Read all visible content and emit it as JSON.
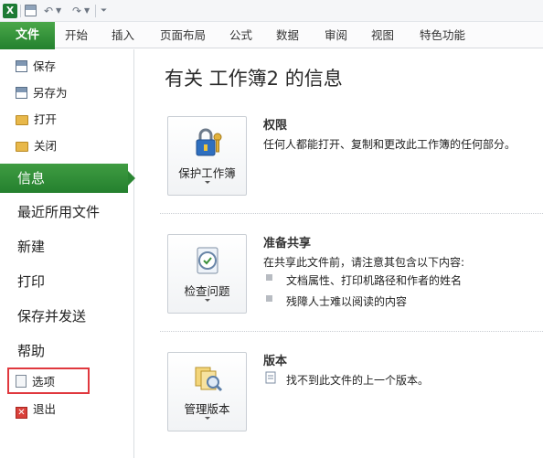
{
  "app_icon_letter": "X",
  "ribbon": {
    "file_tab": "文件",
    "tabs": [
      "开始",
      "插入",
      "页面布局",
      "公式",
      "数据",
      "审阅",
      "视图",
      "特色功能"
    ]
  },
  "nav": {
    "save": "保存",
    "save_as": "另存为",
    "open": "打开",
    "close": "关闭",
    "info": "信息",
    "recent": "最近所用文件",
    "new": "新建",
    "print": "打印",
    "save_send": "保存并发送",
    "help": "帮助",
    "options": "选项",
    "exit": "退出"
  },
  "main": {
    "title": "有关 工作簿2 的信息",
    "permissions": {
      "button": "保护工作簿",
      "heading": "权限",
      "text": "任何人都能打开、复制和更改此工作簿的任何部分。"
    },
    "prepare": {
      "button": "检查问题",
      "heading": "准备共享",
      "text": "在共享此文件前，请注意其包含以下内容:",
      "items": [
        "文档属性、打印机路径和作者的姓名",
        "残障人士难以阅读的内容"
      ]
    },
    "versions": {
      "button": "管理版本",
      "heading": "版本",
      "text": "找不到此文件的上一个版本。"
    }
  },
  "colors": {
    "accent_green": "#2a8632",
    "highlight_red": "#e0383e"
  }
}
